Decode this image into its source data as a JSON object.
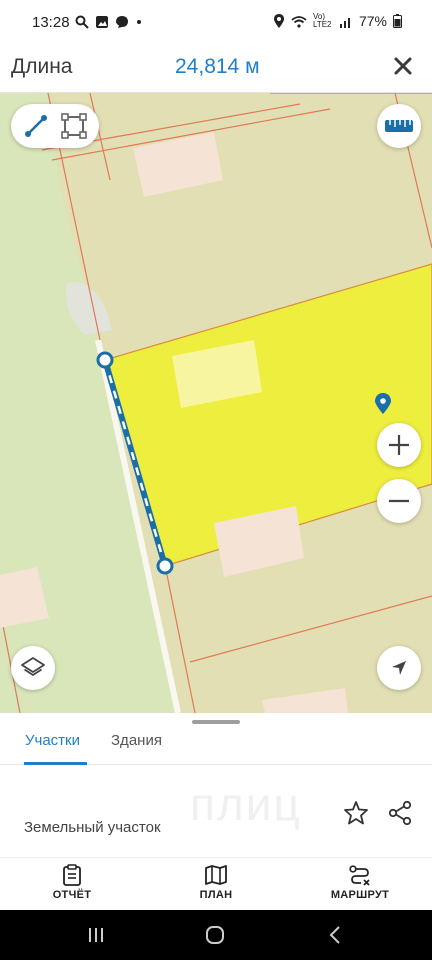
{
  "status_bar": {
    "time": "13:28",
    "battery": "77%",
    "network": "Vo) LTE2",
    "icons": [
      "search-icon",
      "image-icon",
      "chat-icon",
      "dot-icon",
      "location-icon",
      "wifi-icon",
      "signal-icon",
      "battery-icon"
    ]
  },
  "header": {
    "title": "Длина",
    "value": "24,814 м",
    "close_icon": "close-icon"
  },
  "map": {
    "tools": [
      "line-measure-icon",
      "area-measure-icon"
    ],
    "ruler_icon": "ruler-icon",
    "marker_icon": "map-pin-icon",
    "zoom_in_icon": "zoom-in-icon",
    "zoom_out_icon": "zoom-out-icon",
    "layers_icon": "layers-icon",
    "locate_icon": "navigation-arrow-icon",
    "colors": {
      "background": "#dde6be",
      "parcel_fill": "#eeee3e",
      "boundary": "#e07a55",
      "measure_line": "#1a6fa8",
      "building": "#f5e3d6"
    }
  },
  "tabs": [
    {
      "label": "Участки",
      "active": true
    },
    {
      "label": "Здания",
      "active": false
    }
  ],
  "detail": {
    "watermark": "плиц",
    "label": "Земельный участок",
    "star_icon": "star-icon",
    "share_icon": "share-icon"
  },
  "bottom_nav": [
    {
      "label": "ОТЧЁТ",
      "icon": "clipboard-icon"
    },
    {
      "label": "ПЛАН",
      "icon": "map-icon"
    },
    {
      "label": "МАРШРУТ",
      "icon": "route-icon"
    }
  ],
  "system_nav": [
    "recents-icon",
    "home-icon",
    "back-icon"
  ]
}
